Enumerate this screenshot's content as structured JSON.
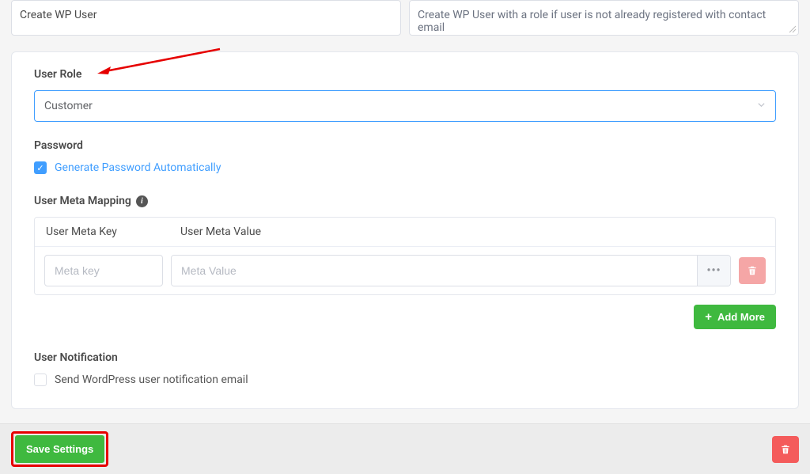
{
  "top": {
    "name_value": "Create WP User",
    "desc_value": "Create WP User with a role if user is not already registered with contact email"
  },
  "form": {
    "user_role": {
      "label": "User Role",
      "selected": "Customer"
    },
    "password": {
      "label": "Password",
      "auto_generate_label": "Generate Password Automatically",
      "auto_generate_checked": true
    },
    "meta": {
      "label": "User Meta Mapping",
      "col_key": "User Meta Key",
      "col_value": "User Meta Value",
      "key_placeholder": "Meta key",
      "value_placeholder": "Meta Value",
      "add_more_label": "Add More"
    },
    "notification": {
      "label": "User Notification",
      "send_label": "Send WordPress user notification email",
      "send_checked": false
    }
  },
  "footer": {
    "save_label": "Save Settings"
  }
}
